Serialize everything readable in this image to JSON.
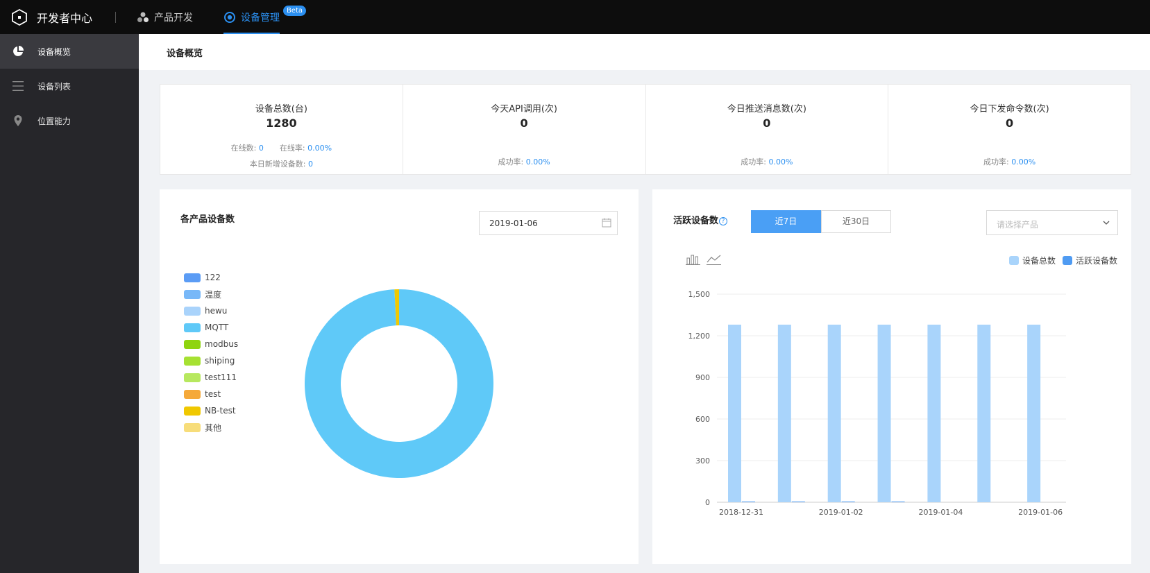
{
  "topbar": {
    "brand": "开发者中心",
    "nav": [
      {
        "label": "产品开发",
        "icon": "cluster-icon",
        "active": false
      },
      {
        "label": "设备管理",
        "icon": "target-icon",
        "active": true,
        "badge": "Beta"
      }
    ]
  },
  "sidebar": {
    "items": [
      {
        "label": "设备概览",
        "icon": "pie-chart-icon",
        "active": true
      },
      {
        "label": "设备列表",
        "icon": "list-icon",
        "active": false
      },
      {
        "label": "位置能力",
        "icon": "location-pin-icon",
        "active": false
      }
    ]
  },
  "page": {
    "title": "设备概览"
  },
  "stats": [
    {
      "label": "设备总数(台)",
      "value": "1280",
      "online_label": "在线数:",
      "online_value": "0",
      "rate_label": "在线率:",
      "rate_value": "0.00%",
      "new_label": "本日新增设备数:",
      "new_value": "0"
    },
    {
      "label": "今天API调用(次)",
      "value": "0",
      "success_label": "成功率:",
      "success_value": "0.00%"
    },
    {
      "label": "今日推送消息数(次)",
      "value": "0",
      "success_label": "成功率:",
      "success_value": "0.00%"
    },
    {
      "label": "今日下发命令数(次)",
      "value": "0",
      "success_label": "成功率:",
      "success_value": "0.00%"
    }
  ],
  "product_panel": {
    "title": "各产品设备数",
    "date": "2019-01-06"
  },
  "active_panel": {
    "title": "活跃设备数",
    "help": "?",
    "tabs": [
      "近7日",
      "近30日"
    ],
    "active_tab": 0,
    "select_placeholder": "请选择产品"
  },
  "chart_data": [
    {
      "type": "pie",
      "donut": true,
      "legend_placement": "left",
      "categories": [
        "122",
        "温度",
        "hewu",
        "MQTT",
        "modbus",
        "shiping",
        "test111",
        "test",
        "NB-test",
        "其他"
      ],
      "colors": [
        "#5b9cf5",
        "#78b8f8",
        "#a9d3fb",
        "#5fc9f8",
        "#8fd40f",
        "#a6e132",
        "#b7e85f",
        "#f5a93a",
        "#f0c800",
        "#f7dd7a"
      ],
      "values": [
        0,
        0,
        0,
        1270,
        0,
        0,
        0,
        0,
        10,
        0
      ]
    },
    {
      "type": "bar",
      "legend_placement": "top-right",
      "categories": [
        "2018-12-31",
        "2019-01-01",
        "2019-01-02",
        "2019-01-03",
        "2019-01-04",
        "2019-01-05",
        "2019-01-06"
      ],
      "tick_labels": [
        "2018-12-31",
        "2019-01-02",
        "2019-01-04",
        "2019-01-06"
      ],
      "series": [
        {
          "name": "设备总数",
          "color": "#a9d4fb",
          "values": [
            1280,
            1280,
            1280,
            1280,
            1280,
            1280,
            1280
          ]
        },
        {
          "name": "活跃设备数",
          "color": "#4f9bf2",
          "values": [
            5,
            5,
            5,
            5,
            0,
            0,
            0
          ]
        }
      ],
      "ylim": [
        0,
        1500
      ],
      "yticks": [
        0,
        300,
        600,
        900,
        1200,
        1500
      ],
      "ytick_labels": [
        "0",
        "300",
        "600",
        "900",
        "1,200",
        "1,500"
      ],
      "grid": true
    }
  ]
}
